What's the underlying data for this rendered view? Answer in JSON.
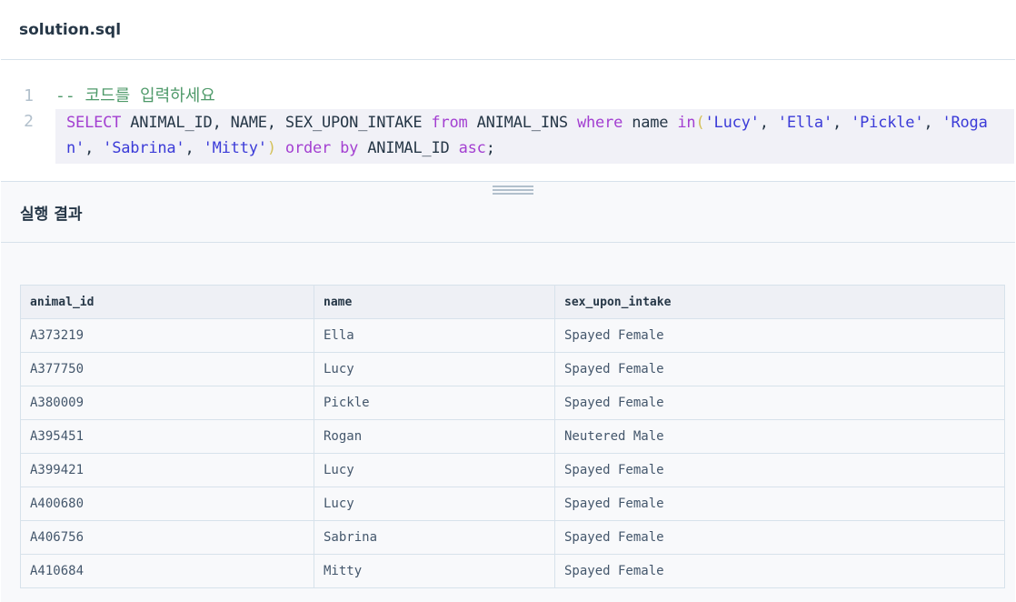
{
  "editor": {
    "file_name": "solution.sql",
    "lines": [
      {
        "number": "1",
        "comment": "-- 코드를 입력하세요"
      },
      {
        "number": "2"
      }
    ],
    "line2_tokens": [
      {
        "t": "SELECT",
        "k": "keyword"
      },
      {
        "t": " ANIMAL_ID, NAME, SEX_UPON_INTAKE ",
        "k": "plain"
      },
      {
        "t": "from",
        "k": "keyword"
      },
      {
        "t": " ANIMAL_INS ",
        "k": "plain"
      },
      {
        "t": "where",
        "k": "keyword"
      },
      {
        "t": " name ",
        "k": "plain"
      },
      {
        "t": "in",
        "k": "keyword"
      },
      {
        "t": "(",
        "k": "paren"
      },
      {
        "t": "'Lucy'",
        "k": "string"
      },
      {
        "t": ", ",
        "k": "punct"
      },
      {
        "t": "'Ella'",
        "k": "string"
      },
      {
        "t": ", ",
        "k": "punct"
      },
      {
        "t": "'Pickle'",
        "k": "string"
      },
      {
        "t": ", ",
        "k": "punct"
      },
      {
        "t": "'Rogan'",
        "k": "string"
      },
      {
        "t": ", ",
        "k": "punct"
      },
      {
        "t": "'Sabrina'",
        "k": "string"
      },
      {
        "t": ", ",
        "k": "punct"
      },
      {
        "t": "'Mitty'",
        "k": "string"
      },
      {
        "t": ")",
        "k": "paren"
      },
      {
        "t": " ",
        "k": "plain"
      },
      {
        "t": "order by",
        "k": "keyword"
      },
      {
        "t": " ANIMAL_ID ",
        "k": "plain"
      },
      {
        "t": "asc",
        "k": "keyword"
      },
      {
        "t": ";",
        "k": "punct"
      }
    ]
  },
  "results": {
    "title": "실행 결과",
    "columns": [
      "animal_id",
      "name",
      "sex_upon_intake"
    ],
    "rows": [
      [
        "A373219",
        "Ella",
        "Spayed Female"
      ],
      [
        "A377750",
        "Lucy",
        "Spayed Female"
      ],
      [
        "A380009",
        "Pickle",
        "Spayed Female"
      ],
      [
        "A395451",
        "Rogan",
        "Neutered Male"
      ],
      [
        "A399421",
        "Lucy",
        "Spayed Female"
      ],
      [
        "A400680",
        "Lucy",
        "Spayed Female"
      ],
      [
        "A406756",
        "Sabrina",
        "Spayed Female"
      ],
      [
        "A410684",
        "Mitty",
        "Spayed Female"
      ]
    ]
  },
  "colors": {
    "keyword": "#a33fd1",
    "string": "#3b3bd8",
    "comment": "#4f9a6a",
    "border": "#d7e2eb"
  },
  "icons": {
    "resize_handle": "drag-handle-icon"
  }
}
